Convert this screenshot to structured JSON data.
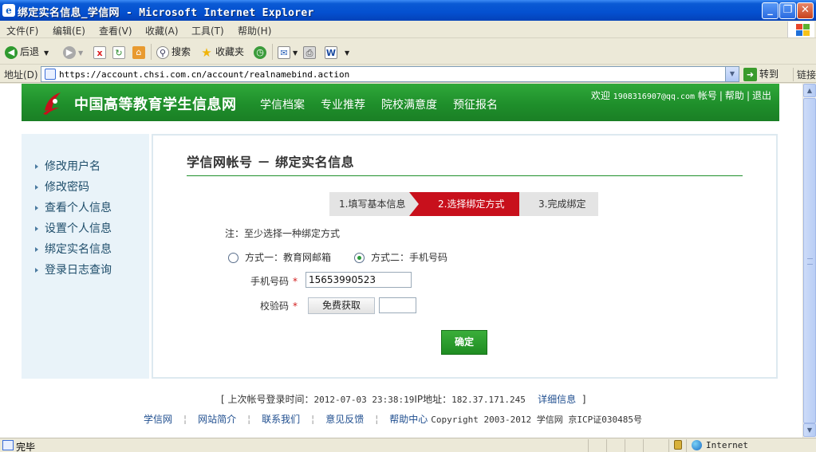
{
  "window": {
    "title": "绑定实名信息_学信网 - Microsoft Internet Explorer",
    "title_icon": "e"
  },
  "menu": [
    "文件(F)",
    "编辑(E)",
    "查看(V)",
    "收藏(A)",
    "工具(T)",
    "帮助(H)"
  ],
  "toolbar": {
    "back": "后退",
    "search": "搜索",
    "favorites": "收藏夹"
  },
  "address": {
    "label": "地址(D)",
    "url": "https://account.chsi.com.cn/account/realnamebind.action",
    "go": "转到",
    "links": "链接"
  },
  "site": {
    "name": "中国高等教育学生信息网",
    "nav": [
      "学信档案",
      "专业推荐",
      "院校满意度",
      "预征报名"
    ],
    "welcome": "欢迎",
    "email": "1908316907@qq.com",
    "account": "帐号",
    "help": "帮助",
    "logout": "退出"
  },
  "sidebar": {
    "items": [
      "修改用户名",
      "修改密码",
      "查看个人信息",
      "设置个人信息",
      "绑定实名信息",
      "登录日志查询"
    ]
  },
  "main": {
    "title": "学信网帐号 － 绑定实名信息",
    "steps": [
      "1.填写基本信息",
      "2.选择绑定方式",
      "3.完成绑定"
    ],
    "active_step": 2,
    "note": "注：至少选择一种绑定方式",
    "options": [
      {
        "label": "方式一：教育网邮箱",
        "selected": false
      },
      {
        "label": "方式二：手机号码",
        "selected": true
      }
    ],
    "phone_label": "手机号码",
    "phone_value": "15653990523",
    "code_label": "校验码",
    "code_value": "",
    "get_code": "免费获取",
    "submit": "确定"
  },
  "footer": {
    "last_login_label": "上次帐号登录时间：",
    "last_login_time": "2012-07-03 23:38:19",
    "ip_label": "IP地址：",
    "ip": "182.37.171.245",
    "details": "详细信息",
    "links": [
      "学信网",
      "网站简介",
      "联系我们",
      "意见反馈",
      "帮助中心"
    ],
    "copyright": "Copyright 2003-2012 学信网 京ICP证030485号"
  },
  "status": {
    "text": "完毕",
    "zone": "Internet"
  },
  "colors": {
    "header_green": "#1f8f2b",
    "step_active": "#c8101c",
    "sidebar_bg": "#e9f3f9"
  }
}
